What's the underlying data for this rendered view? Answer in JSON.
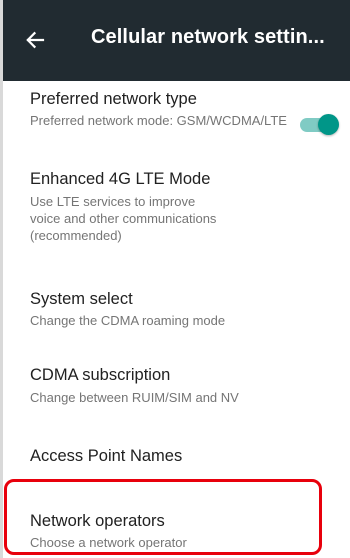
{
  "app_bar": {
    "title": "Cellular network settin...",
    "back_icon": "arrow-left-icon",
    "background": "#212b31"
  },
  "settings": {
    "preferred_network": {
      "title": "Preferred network type",
      "summary": "Preferred network mode: GSM/WCDMA/LTE"
    },
    "enhanced_lte": {
      "title": "Enhanced 4G LTE Mode",
      "summary_lines": [
        "Use LTE services to improve",
        "voice and other communications",
        "(recommended)"
      ],
      "toggle_on": true,
      "accent": "#009688"
    },
    "system_select": {
      "title": "System select",
      "summary": "Change the CDMA roaming mode"
    },
    "cdma_subscription": {
      "title": "CDMA subscription",
      "summary": "Change between RUIM/SIM and NV"
    },
    "access_point_names": {
      "title": "Access Point Names"
    },
    "network_operators": {
      "title": "Network operators",
      "summary": "Choose a network operator"
    }
  },
  "highlight_color": "#e8000c"
}
